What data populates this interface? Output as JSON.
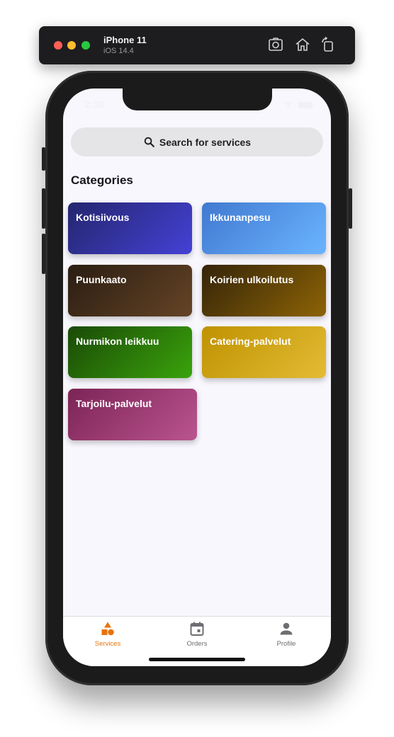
{
  "simulator": {
    "device": "iPhone 11",
    "os": "iOS 14.4",
    "icons": [
      "screenshot-icon",
      "home-icon",
      "rotate-icon"
    ]
  },
  "status_bar": {
    "time": "2:30"
  },
  "search": {
    "label": "Search for services",
    "icon": "search-icon"
  },
  "categories": {
    "title": "Categories",
    "items": [
      {
        "label": "Kotisiivous",
        "colors": [
          "#24266e",
          "#4541d6"
        ]
      },
      {
        "label": "Ikkunanpesu",
        "colors": [
          "#4179d0",
          "#6ab4ff"
        ]
      },
      {
        "label": "Puunkaato",
        "colors": [
          "#2a1d12",
          "#654426"
        ]
      },
      {
        "label": "Koirien ulkoilutus",
        "colors": [
          "#342409",
          "#8d6305"
        ]
      },
      {
        "label": "Nurmikon leikkuu",
        "colors": [
          "#1a4a07",
          "#3aa30b"
        ]
      },
      {
        "label": "Catering-palvelut",
        "colors": [
          "#bf9201",
          "#e3bb34"
        ]
      },
      {
        "label": "Tarjoilu-palvelut",
        "colors": [
          "#7c2456",
          "#ba5490"
        ]
      }
    ]
  },
  "tabbar": {
    "active_color": "#e8720c",
    "inactive_color": "#6d6d72",
    "tabs": [
      {
        "label": "Services",
        "icon": "services-shapes-icon",
        "active": true
      },
      {
        "label": "Orders",
        "icon": "calendar-icon",
        "active": false
      },
      {
        "label": "Profile",
        "icon": "person-icon",
        "active": false
      }
    ]
  }
}
